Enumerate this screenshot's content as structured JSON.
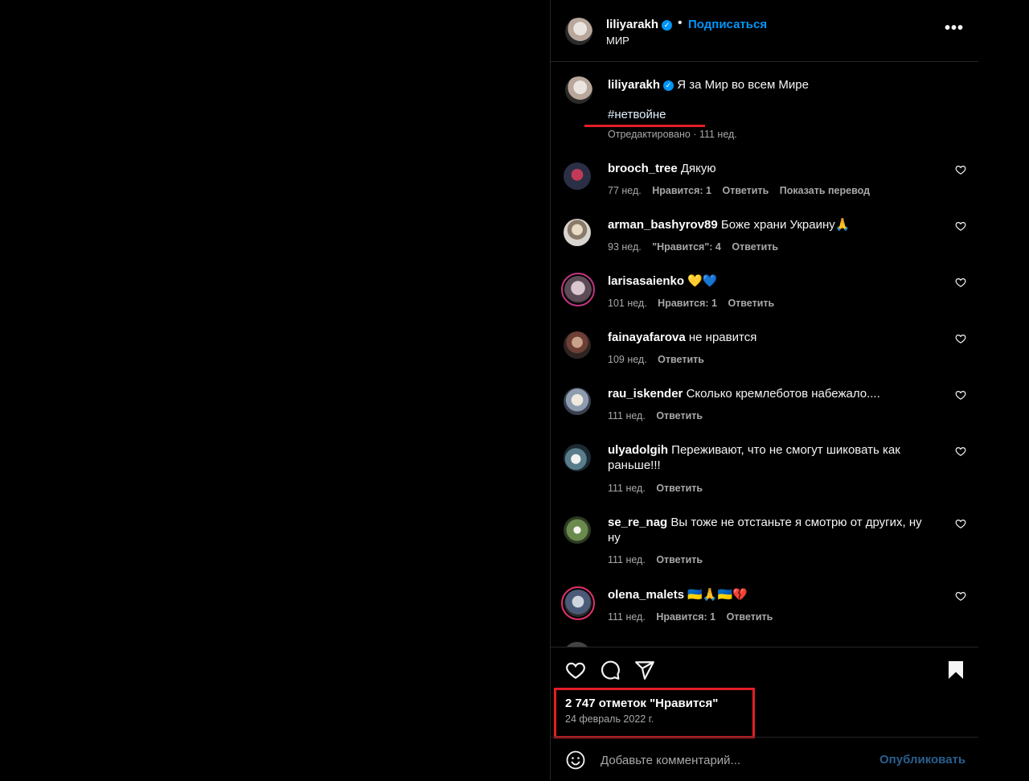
{
  "post": {
    "username": "liliyarakh",
    "follow_label": "Подписаться",
    "location": "МИР",
    "more_label": "•••"
  },
  "caption": {
    "username": "liliyarakh",
    "text": "Я за Мир во всем Мире",
    "hashtag": "#нетвойне",
    "meta": "Отредактировано · 111 нед."
  },
  "comments": [
    {
      "username": "brooch_tree",
      "text": "Дякую",
      "time": "77 нед.",
      "likes": "Нравится: 1",
      "reply": "Ответить",
      "translate": "Показать перевод"
    },
    {
      "username": "arman_bashyrov89",
      "text": "Боже храни Украину🙏",
      "time": "93 нед.",
      "likes": "\"Нравится\": 4",
      "reply": "Ответить"
    },
    {
      "username": "larisasaienko",
      "text": "💛💙",
      "time": "101 нед.",
      "likes": "Нравится: 1",
      "reply": "Ответить"
    },
    {
      "username": "fainayafarova",
      "text": "не нравится",
      "time": "109 нед.",
      "reply": "Ответить"
    },
    {
      "username": "rau_iskender",
      "text": "Сколько кремлеботов набежало....",
      "time": "111 нед.",
      "reply": "Ответить"
    },
    {
      "username": "ulyadolgih",
      "text": "Переживают, что не смогут шиковать как раньше!!!",
      "time": "111 нед.",
      "reply": "Ответить"
    },
    {
      "username": "se_re_nag",
      "text": "Вы тоже не отстаньте я смотрю от других, ну ну",
      "time": "111 нед.",
      "reply": "Ответить"
    },
    {
      "username": "olena_malets",
      "text": "🇺🇦🙏🇺🇦💔",
      "time": "111 нед.",
      "likes": "Нравится: 1",
      "reply": "Ответить"
    }
  ],
  "stats": {
    "likes": "2 747 отметок \"Нравится\"",
    "date": "24 февраль 2022 г."
  },
  "add_comment": {
    "placeholder": "Добавьте комментарий...",
    "publish_label": "Опубликовать"
  },
  "colors": {
    "accent": "#0095f6",
    "highlight": "#e41e26",
    "muted": "#a8a8a8"
  }
}
